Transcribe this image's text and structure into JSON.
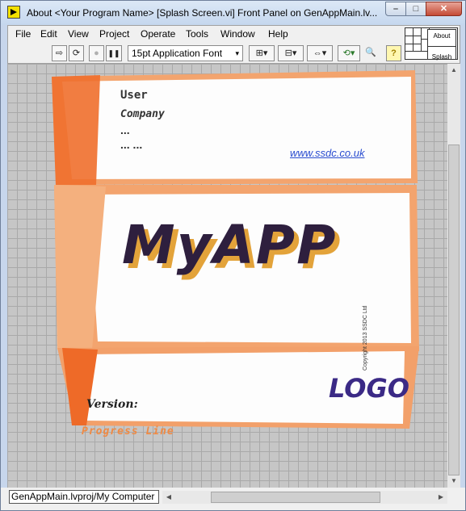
{
  "window": {
    "title": "About <Your Program Name> [Splash Screen.vi] Front Panel on GenAppMain.lv...",
    "min_glyph": "⎯",
    "max_glyph": "□",
    "close_glyph": "✕"
  },
  "menu": [
    "File",
    "Edit",
    "View",
    "Project",
    "Operate",
    "Tools",
    "Window",
    "Help"
  ],
  "toolbar": {
    "run_glyph": "⇨",
    "run_continuous_glyph": "⟳",
    "abort_glyph": "●",
    "pause_glyph": "❚❚",
    "font_label": "15pt Application Font",
    "font_arrow": "▾",
    "align_glyph": "⊞▾",
    "distribute_glyph": "⊟▾",
    "resize_glyph": "⇔▾",
    "reorder_glyph": "⟲▾",
    "search_glyph": "🔍",
    "help_glyph": "?"
  },
  "vi_icon": {
    "line1": "About",
    "line2": "Splash"
  },
  "splash": {
    "user_label": "User",
    "company_label": "Company",
    "dots1": "...",
    "dots2": "... ...",
    "website": "www.ssdc.co.uk",
    "app_name": "MyAPP",
    "logo": "LOGO",
    "version_label": "Version:",
    "progress_label": "Progress Line",
    "copyright": "Copyright 2013 SSDC Ltd",
    "colors": {
      "orange": "#f07a3a",
      "app_name": "#2e1f3e",
      "app_shadow": "#e3a33a",
      "logo": "#3b2a86",
      "link": "#2a4dd0"
    }
  },
  "status": {
    "project_path": "GenAppMain.lvproj/My Computer"
  },
  "scroll": {
    "up": "▲",
    "down": "▼",
    "left": "◀",
    "right": "▶"
  }
}
